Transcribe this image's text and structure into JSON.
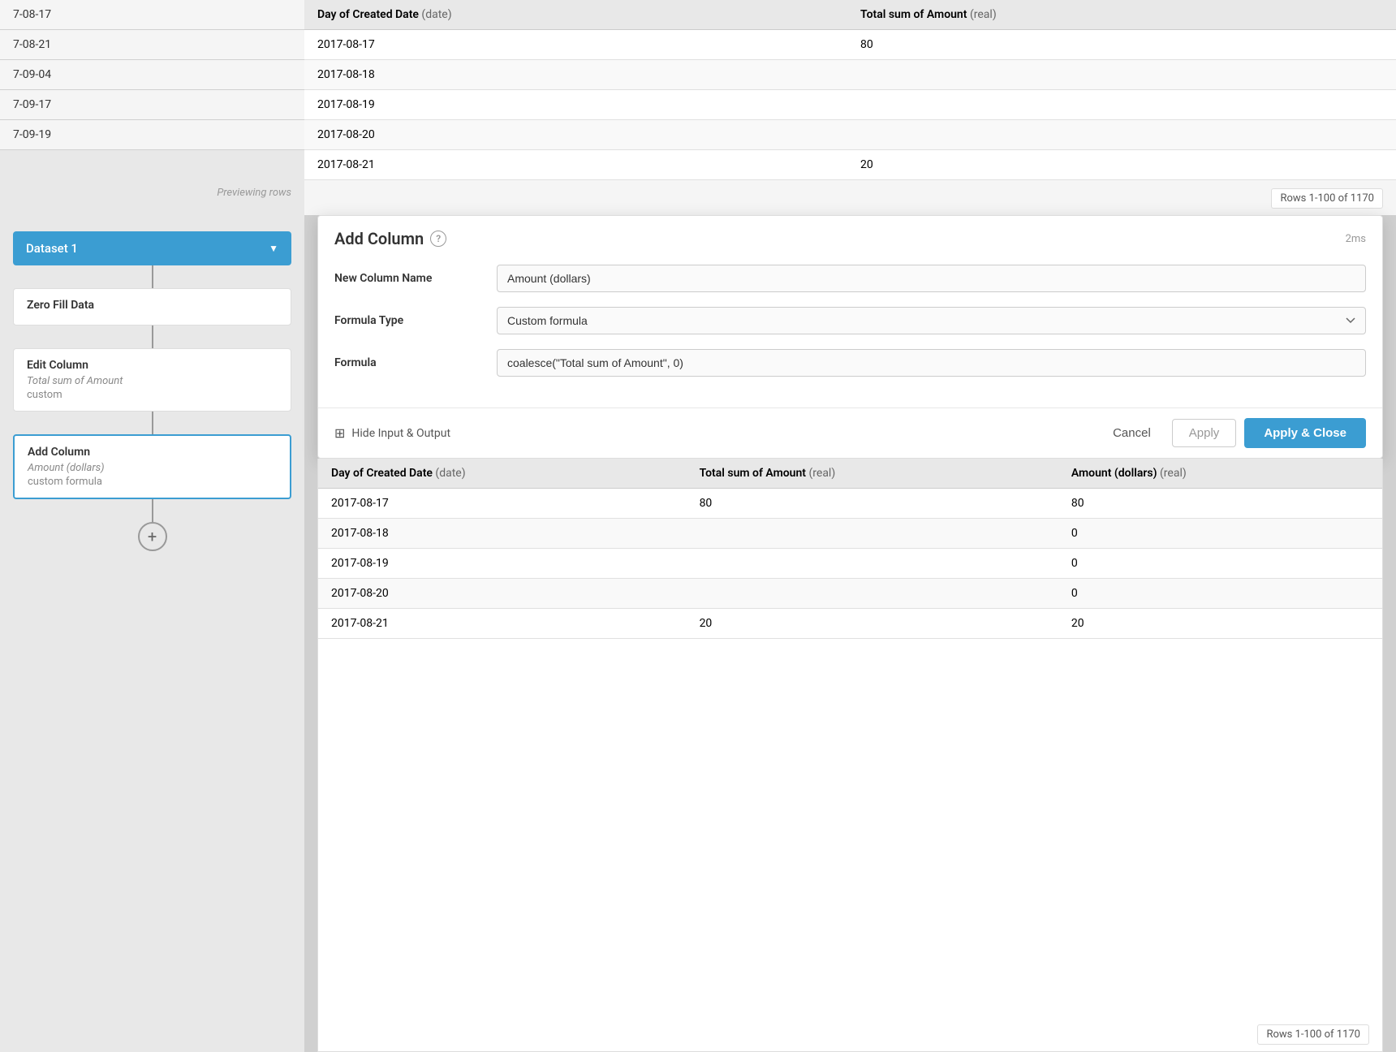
{
  "sidebar": {
    "dataset_label": "Dataset 1",
    "previewing_text": "Previewing rows",
    "nodes": [
      {
        "type": "dataset",
        "label": "Dataset 1"
      },
      {
        "type": "transform",
        "title": "Zero Fill Data",
        "subtitle": "",
        "tag": ""
      },
      {
        "type": "transform",
        "title": "Edit Column",
        "subtitle": "Total sum of Amount",
        "tag": "custom"
      },
      {
        "type": "transform",
        "title": "Add Column",
        "subtitle": "Amount (dollars)",
        "tag": "custom formula"
      }
    ]
  },
  "top_table": {
    "columns": [
      {
        "name": "Day of Created Date",
        "type": "date"
      },
      {
        "name": "Total sum of Amount",
        "type": "real"
      }
    ],
    "rows": [
      {
        "date": "2017-08-17",
        "amount": "80"
      },
      {
        "date": "2017-08-18",
        "amount": ""
      },
      {
        "date": "2017-08-19",
        "amount": ""
      },
      {
        "date": "2017-08-20",
        "amount": ""
      },
      {
        "date": "2017-08-21",
        "amount": "20"
      }
    ],
    "rows_indicator": "Rows 1-100 of 1170"
  },
  "sidebar_dates": [
    "7-08-17",
    "7-08-21",
    "7-09-04",
    "7-09-17",
    "7-09-19"
  ],
  "modal": {
    "title": "Add Column",
    "timing": "2ms",
    "help_label": "?",
    "fields": {
      "column_name_label": "New Column Name",
      "column_name_value": "Amount (dollars)",
      "formula_type_label": "Formula Type",
      "formula_type_value": "Custom formula",
      "formula_label": "Formula",
      "formula_value": "coalesce(\"Total sum of Amount\", 0)"
    },
    "footer": {
      "hide_label": "Hide Input & Output",
      "cancel_label": "Cancel",
      "apply_label": "Apply",
      "apply_close_label": "Apply & Close"
    }
  },
  "output_table": {
    "columns": [
      {
        "name": "Day of Created Date",
        "type": "date"
      },
      {
        "name": "Total sum of Amount",
        "type": "real"
      },
      {
        "name": "Amount (dollars)",
        "type": "real"
      }
    ],
    "rows": [
      {
        "date": "2017-08-17",
        "total": "80",
        "amount": "80"
      },
      {
        "date": "2017-08-18",
        "total": "",
        "amount": "0"
      },
      {
        "date": "2017-08-19",
        "total": "",
        "amount": "0"
      },
      {
        "date": "2017-08-20",
        "total": "",
        "amount": "0"
      },
      {
        "date": "2017-08-21",
        "total": "20",
        "amount": "20"
      }
    ],
    "rows_indicator": "Rows 1-100 of 1170"
  }
}
